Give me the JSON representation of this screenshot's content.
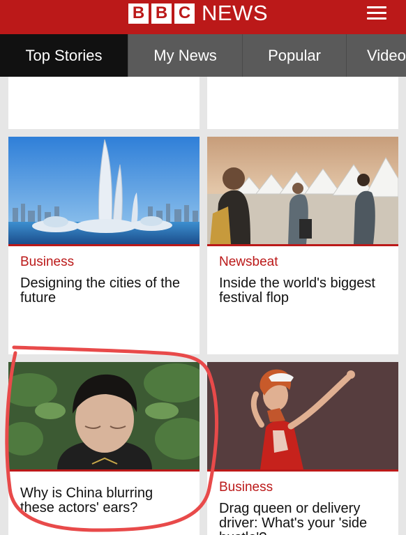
{
  "header": {
    "logo_letters": [
      "B",
      "B",
      "C"
    ],
    "logo_word": "NEWS",
    "brand_color": "#bb1919"
  },
  "tabs": [
    {
      "label": "Top Stories",
      "active": true
    },
    {
      "label": "My News",
      "active": false
    },
    {
      "label": "Popular",
      "active": false
    },
    {
      "label": "Video",
      "active": false
    }
  ],
  "stories": [
    {
      "section": "Business",
      "headline": "Designing the cities of the future"
    },
    {
      "section": "Newsbeat",
      "headline": "Inside the world's biggest festival flop"
    },
    {
      "section": "",
      "headline": "Why is China blurring these actors' ears?"
    },
    {
      "section": "Business",
      "headline": "Drag queen or delivery driver: What's your 'side hustle'?"
    }
  ],
  "annotation": {
    "color": "#e84a4a",
    "shape": "hand-drawn circle around story 3"
  }
}
